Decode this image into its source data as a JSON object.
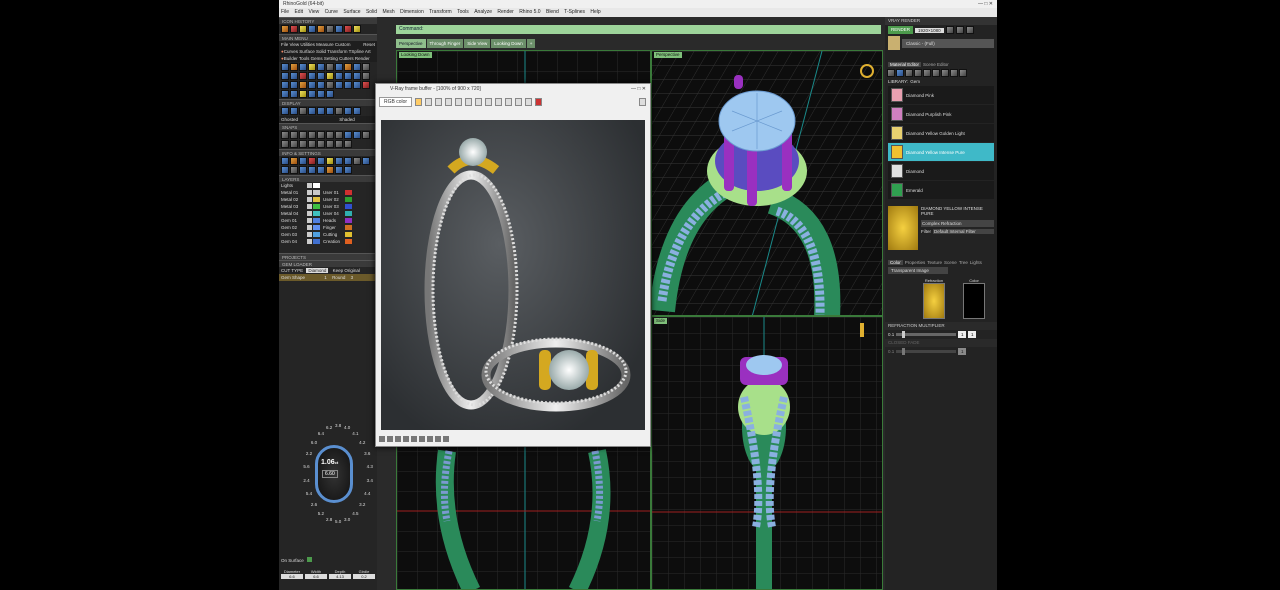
{
  "titlebar": {
    "text": "RhinoGold (64-bit)",
    "controls": "—  □  ✕"
  },
  "menubar": [
    "File",
    "Edit",
    "View",
    "Curve",
    "Surface",
    "Solid",
    "Mesh",
    "Dimension",
    "Transform",
    "Tools",
    "Analyze",
    "Render",
    "Rhino 5.0",
    "Blend",
    "T-Splines",
    "Help"
  ],
  "leftpanel": {
    "icon_history": "ICON HISTORY",
    "main_menu": "MAIN MENU",
    "main_menu_items": [
      "File  View  Utilities  Measure  Custom",
      "Curves  Surface  Solid  Transform  TSpline  Art",
      "Builder  Tools  Gems  Setting  Cutters  Render"
    ],
    "main_menu_reset": "Reset",
    "display": "DISPLAY",
    "display_mode": "Ghosted",
    "display_mode2": "Shaded",
    "snaps": "SNAPS",
    "info_settings": "INFO & SETTINGS",
    "layers": "LAYERS",
    "layers_lights": "Lights",
    "layer_rows": [
      {
        "a": "Metal 01",
        "b": "User 01",
        "ca": "#c8c8c8",
        "cb": "#d03030"
      },
      {
        "a": "Metal 02",
        "b": "User 02",
        "ca": "#e0c040",
        "cb": "#30a030"
      },
      {
        "a": "Metal 03",
        "b": "User 03",
        "ca": "#40c040",
        "cb": "#3050d0"
      },
      {
        "a": "Metal 04",
        "b": "User 04",
        "ca": "#40c0c0",
        "cb": "#30b0b0"
      },
      {
        "a": "Gem 01",
        "b": "Heads",
        "ca": "#5080e0",
        "cb": "#9030c0"
      },
      {
        "a": "Gem 02",
        "b": "Finger",
        "ca": "#6090f0",
        "cb": "#d07020"
      },
      {
        "a": "Gem 03",
        "b": "Cutting",
        "ca": "#50a0e0",
        "cb": "#e0c030"
      },
      {
        "a": "Gem 04",
        "b": "Creation",
        "ca": "#4070d0",
        "cb": "#e06020"
      }
    ],
    "projects": "PROJECTS",
    "gem_loader": "GEM LOADER",
    "cut_type_label": "CUT TYPE",
    "cut_type_value": "Diamond",
    "keep_original": "Keep Original",
    "gem_shape_label": "Gem Shape",
    "gem_shape_value": "Round",
    "gem_shape_num": "1",
    "gem_shape_count": "3",
    "dial_value": "1.06",
    "dial_unit": "ct",
    "dial_mm": "6.60",
    "dial_labels": [
      "3.8",
      "4.0",
      "4.1",
      "4.2",
      "3.6",
      "4.3",
      "3.4",
      "4.4",
      "3.2",
      "4.5",
      "3.0",
      "5.0",
      "2.8",
      "5.2",
      "2.6",
      "5.4",
      "2.4",
      "5.6",
      "2.2",
      "6.0",
      "6.4",
      "6.2"
    ],
    "on_surface": "On Surface",
    "bottom_fields": [
      "Diameter",
      "Width",
      "Depth",
      "Girdle"
    ],
    "bottom_values": [
      "6.6",
      "6.6",
      "4.13",
      "0.2"
    ]
  },
  "command": {
    "label": "Command:"
  },
  "viewtabs": [
    "Perspective",
    "Through Finger",
    "Side View",
    "Looking Down"
  ],
  "viewports": {
    "top_left": "Looking Down",
    "perspective": "Perspective",
    "side": "Side"
  },
  "renderwin": {
    "title": "V-Ray frame buffer - [100% of 900 x 720]",
    "channel": "RGB color",
    "controls": "—  □  ✕"
  },
  "rightpanel": {
    "header": "VRAY RENDER",
    "render_btn": "RENDER",
    "resolution": "1920×1080",
    "preset_name": "Classic - (Full)",
    "tabs": [
      "Material Editor",
      "Scene Editor"
    ],
    "library_label": "LIBRARY:",
    "library_value": "Gem",
    "materials": [
      {
        "name": "Diamond Pink",
        "color": "#e8a0b0"
      },
      {
        "name": "Diamond Purplish Pink",
        "color": "#d080c0"
      },
      {
        "name": "Diamond Yellow Golden Light",
        "color": "#e8d070"
      },
      {
        "name": "Diamond Yellow Intense Pure",
        "color": "#f0c030"
      },
      {
        "name": "Diamond",
        "color": "#e0e0e0"
      },
      {
        "name": "Emerald",
        "color": "#30a050"
      }
    ],
    "selected_material": "DIAMOND YELLOW INTENSE PURE",
    "mat_type": "Complex Refraction",
    "mat_field_label": "Filter",
    "mat_field_value": "Default Internal Filter",
    "bottom_tabs": [
      "Color",
      "Properties",
      "Texture",
      "Scene",
      "Tree",
      "Lights"
    ],
    "transparent_label": "Transparent Image",
    "swatch_labels": [
      "Refraction",
      "Color"
    ],
    "refraction_label": "REFRACTION MULTIPLIER",
    "refraction_value": "0.1",
    "refraction_num": "1",
    "refraction_num2": "1",
    "second_label": "CLOSED FADE",
    "second_value": "0.1",
    "second_num": "1"
  },
  "colors": {
    "accent_green": "#4c9a4c",
    "cmd_green": "#9dd49a",
    "select_cyan": "#3fb9c8"
  }
}
